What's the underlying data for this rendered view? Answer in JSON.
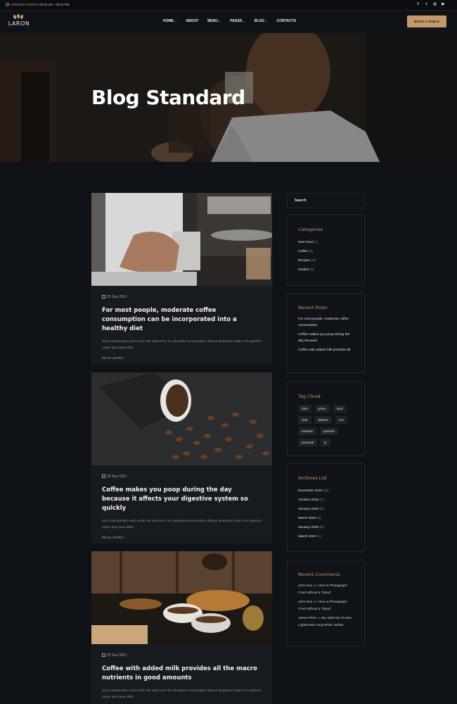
{
  "topbar": {
    "hours_label": "OPENING HOURS:",
    "hours_value": "08:00 AM - 09:00 PM",
    "socials": [
      "f",
      "t",
      "◎",
      "▶"
    ]
  },
  "nav": {
    "logo": "LARON",
    "items": [
      {
        "label": "HOME",
        "dropdown": true
      },
      {
        "label": "ABOUT",
        "dropdown": false
      },
      {
        "label": "MENU",
        "dropdown": true
      },
      {
        "label": "PAGES",
        "dropdown": true
      },
      {
        "label": "BLOG",
        "dropdown": true
      },
      {
        "label": "CONTACTS",
        "dropdown": false
      }
    ],
    "book_button": "BOOK A TABLE"
  },
  "hero": {
    "title": "Blog Standard"
  },
  "posts": [
    {
      "date": "25 Sep 2021",
      "title": "For most people, moderate coffee consumption can be incorporated into a healthy diet",
      "excerpt": "Sed ut perspiciatis unde omnis iste natus error sit voluptatem accusantium dlorque laudantium totam rem aperiam eaque ipsa quae abillo",
      "read_more": "READ MORE"
    },
    {
      "date": "25 Sep 2021",
      "title": "Coffee makes you poop during the day because it affects your digestive system so quickly",
      "excerpt": "Sed ut perspiciatis unde omnis iste natus error sit voluptatem accusantium dlorque laudantium totam rem aperiam eaque ipsa quae abillo",
      "read_more": "READ MORE"
    },
    {
      "date": "25 Sep 2021",
      "title": "Coffee with added milk provides all the macro nutrients in good amounts",
      "excerpt": "Sed ut perspiciatis unde omnis iste natus error sit voluptatem accusantium dlorque laudantium totam rem aperiam eaque ipsa quae abillo",
      "read_more": "READ MORE"
    }
  ],
  "sidebar": {
    "search_placeholder": "Search",
    "categories": {
      "title": "Categories",
      "items": [
        {
          "label": "Sea Food",
          "count": "(1)"
        },
        {
          "label": "Coffee",
          "count": "(2)"
        },
        {
          "label": "Recipes",
          "count": "(4)"
        },
        {
          "label": "Guides",
          "count": "(5)"
        }
      ]
    },
    "recent_posts": {
      "title": "Recent Posts",
      "items": [
        "For most people, moderate coffee consumption",
        "Coffee makes you poop during the day because",
        "Coffee with added milk provides all"
      ]
    },
    "tag_cloud": {
      "title": "Tag Cloud",
      "tags": [
        "html",
        "photo",
        "food",
        "chat",
        "fashion",
        "css",
        "embeds",
        "portfolio",
        "personal",
        "js"
      ]
    },
    "archives": {
      "title": "Archives List",
      "items": [
        {
          "label": "November 2019",
          "count": "(11)"
        },
        {
          "label": "October 2019",
          "count": "(1)"
        },
        {
          "label": "January 2020",
          "count": "(5)"
        },
        {
          "label": "March 2020",
          "count": "(5)"
        },
        {
          "label": "January 2020",
          "count": "(6)"
        },
        {
          "label": "March 2020",
          "count": "(1)"
        }
      ]
    },
    "recent_comments": {
      "title": "Recent Comments",
      "items": [
        {
          "author": "John Doe",
          "on": "on",
          "post": "How to Photograph Food without a Tripod"
        },
        {
          "author": "John Doe",
          "on": "on",
          "post": "How to Photograph Food without a Tripod"
        },
        {
          "author": "James Flick",
          "on": "on",
          "post": "My Style My Choise Lighthouse Long White Jacket"
        }
      ]
    }
  },
  "colors": {
    "accent": "#c49a6c",
    "background": "#0f1216",
    "card": "#171a1f"
  }
}
